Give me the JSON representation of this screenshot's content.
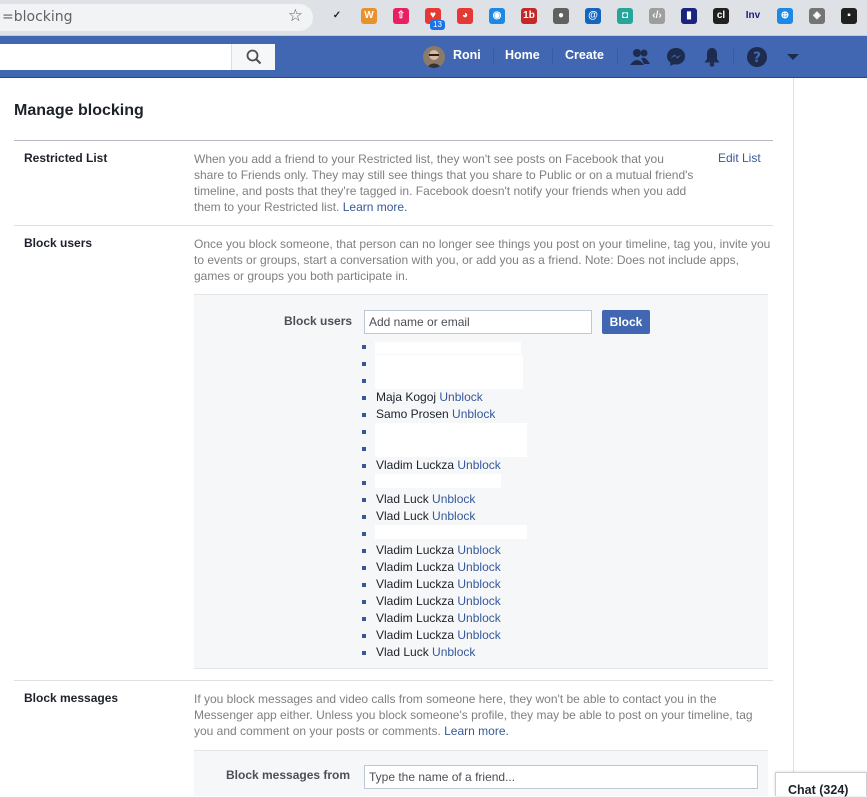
{
  "browser": {
    "url": "=blocking",
    "extension_badge": "13",
    "extensions": [
      "✓",
      "W",
      "⇧",
      "♥",
      "◕",
      "◉",
      "1b",
      "●",
      "@",
      "◘",
      "‹/›",
      "▮",
      "cl",
      "Inv",
      "⊕",
      "◈",
      "▪"
    ]
  },
  "fb_nav": {
    "user_name": "Roni",
    "home": "Home",
    "create": "Create"
  },
  "page": {
    "title": "Manage blocking"
  },
  "restricted": {
    "label": "Restricted List",
    "desc": "When you add a friend to your Restricted list, they won't see posts on Facebook that you share to Friends only. They may still see things that you share to Public or on a mutual friend's timeline, and posts that they're tagged in. Facebook doesn't notify your friends when you add them to your Restricted list.",
    "learn_more": "Learn more.",
    "edit": "Edit List"
  },
  "block_users": {
    "label": "Block users",
    "desc": "Once you block someone, that person can no longer see things you post on your timeline, tag you, invite you to events or groups, start a conversation with you, or add you as a friend. Note: Does not include apps, games or groups you both participate in.",
    "field_label": "Block users",
    "placeholder": "Add name or email",
    "button": "Block",
    "unblock": "Unblock",
    "list": [
      {
        "name": "",
        "redacted": true
      },
      {
        "name": "",
        "redacted": true
      },
      {
        "name": "",
        "redacted": true
      },
      {
        "name": "Maja Kogoj",
        "redacted": false
      },
      {
        "name": "Samo Prosen",
        "redacted": false
      },
      {
        "name": "",
        "redacted": true
      },
      {
        "name": "",
        "redacted": true
      },
      {
        "name": "Vladim Luckza",
        "redacted": false
      },
      {
        "name": "",
        "redacted": true
      },
      {
        "name": "Vlad Luck",
        "redacted": false
      },
      {
        "name": "Vlad Luck",
        "redacted": false
      },
      {
        "name": "",
        "redacted": true
      },
      {
        "name": "Vladim Luckza",
        "redacted": false
      },
      {
        "name": "Vladim Luckza",
        "redacted": false
      },
      {
        "name": "Vladim Luckza",
        "redacted": false
      },
      {
        "name": "Vladim Luckza",
        "redacted": false
      },
      {
        "name": "Vladim Luckza",
        "redacted": false
      },
      {
        "name": "Vladim Luckza",
        "redacted": false
      },
      {
        "name": "Vlad Luck",
        "redacted": false
      }
    ]
  },
  "block_messages": {
    "label": "Block messages",
    "desc": "If you block messages and video calls from someone here, they won't be able to contact you in the Messenger app either. Unless you block someone's profile, they may be able to post on your timeline, tag you and comment on your posts or comments.",
    "learn_more": "Learn more.",
    "field_label": "Block messages from",
    "placeholder": "Type the name of a friend..."
  },
  "chat": {
    "label": "Chat (324)"
  },
  "colors": {
    "fb_blue": "#4267b2",
    "link": "#365899"
  }
}
